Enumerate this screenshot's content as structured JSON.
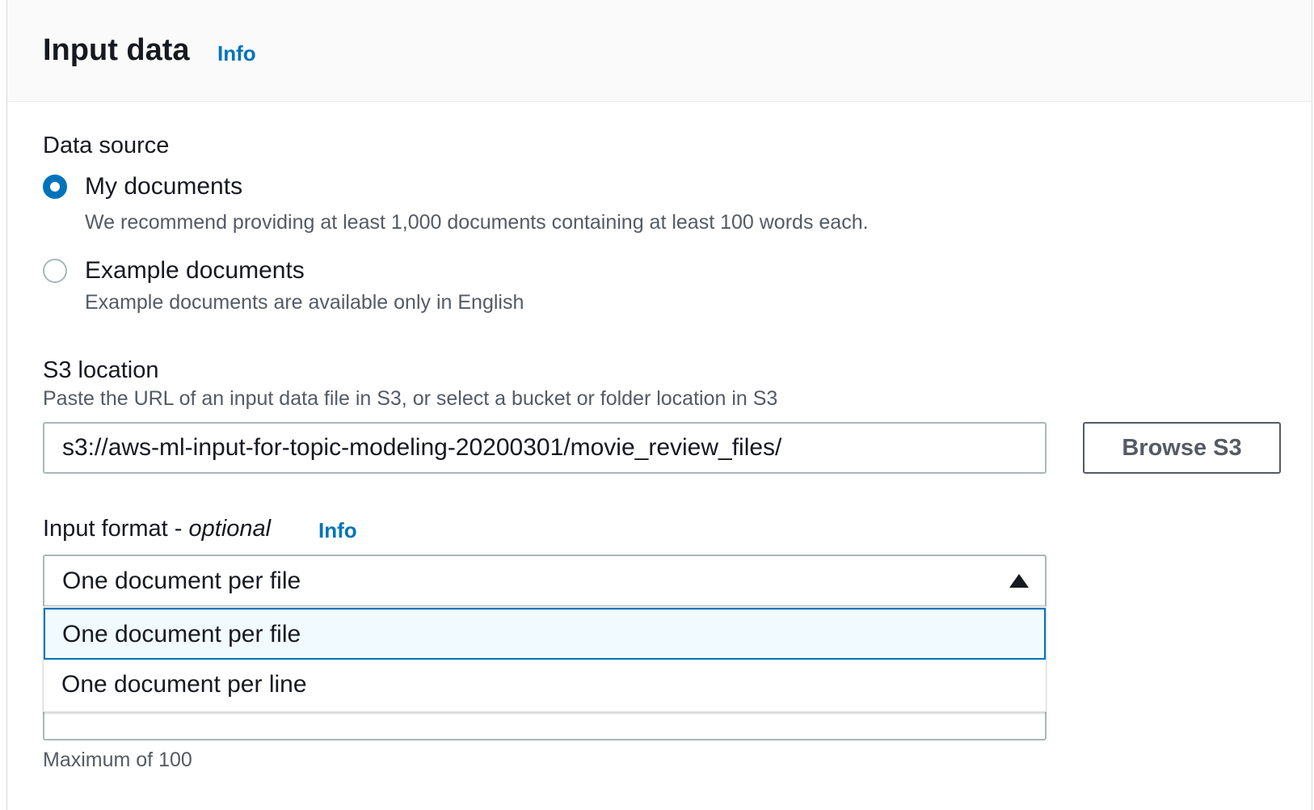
{
  "header": {
    "title": "Input data",
    "info_label": "Info"
  },
  "data_source": {
    "label": "Data source",
    "options": [
      {
        "label": "My documents",
        "description": "We recommend providing at least 1,000 documents containing at least 100 words each.",
        "selected": true
      },
      {
        "label": "Example documents",
        "description": "Example documents are available only in English",
        "selected": false
      }
    ]
  },
  "s3_location": {
    "label": "S3 location",
    "description": "Paste the URL of an input data file in S3, or select a bucket or folder location in S3",
    "value": "s3://aws-ml-input-for-topic-modeling-20200301/movie_review_files/",
    "browse_label": "Browse S3"
  },
  "input_format": {
    "label": "Input format - ",
    "optional_label": "optional",
    "info_label": "Info",
    "selected_value": "One document per file",
    "expanded": true,
    "options": [
      "One document per file",
      "One document per line"
    ]
  },
  "topics": {
    "constraint": "Maximum of 100"
  },
  "colors": {
    "accent": "#0073bb",
    "text": "#16191f",
    "secondary_text": "#545b64",
    "border": "#aab7b8",
    "option_highlight": "#f1faff"
  }
}
